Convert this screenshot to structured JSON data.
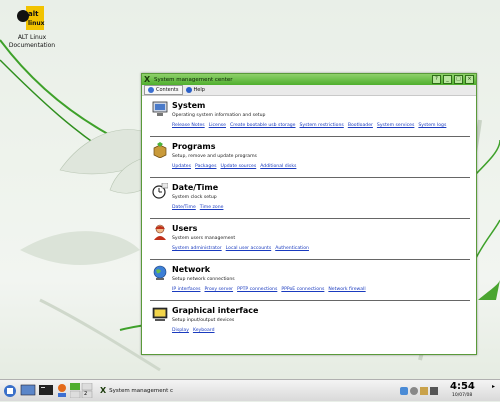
{
  "desktop": {
    "icon_label": "ALT Linux\nDocumentation",
    "logo_text": "alt linux"
  },
  "window": {
    "title": "System management center"
  },
  "toolbar": {
    "contents": "Contents",
    "help": "Help"
  },
  "sections": [
    {
      "title": "System",
      "desc": "Operating system information and setup",
      "links": [
        "Release Notes",
        "License",
        "Create bootable usb storage",
        "System restrictions",
        "Bootloader",
        "System services",
        "System logs"
      ]
    },
    {
      "title": "Programs",
      "desc": "Setup, remove and update programs",
      "links": [
        "Updates",
        "Packages",
        "Update sources",
        "Additional disks"
      ]
    },
    {
      "title": "Date/Time",
      "desc": "System clock setup",
      "links": [
        "Date/Time",
        "Time zone"
      ]
    },
    {
      "title": "Users",
      "desc": "System users management",
      "links": [
        "System administrator",
        "Local user accounts",
        "Authentication"
      ]
    },
    {
      "title": "Network",
      "desc": "Setup network connections",
      "links": [
        "IP interfaces",
        "Proxy server",
        "PPTP connections",
        "PPPoE connections",
        "Network firewall"
      ]
    },
    {
      "title": "Graphical interface",
      "desc": "Setup input/output devices",
      "links": [
        "Display",
        "Keyboard"
      ]
    }
  ],
  "taskbar": {
    "task_label": "System management c",
    "desk_num": "2",
    "clock": "4:54",
    "date": "10/07/08"
  },
  "colors": {
    "accent": "#4fae2e",
    "link": "#1a3bbf"
  }
}
